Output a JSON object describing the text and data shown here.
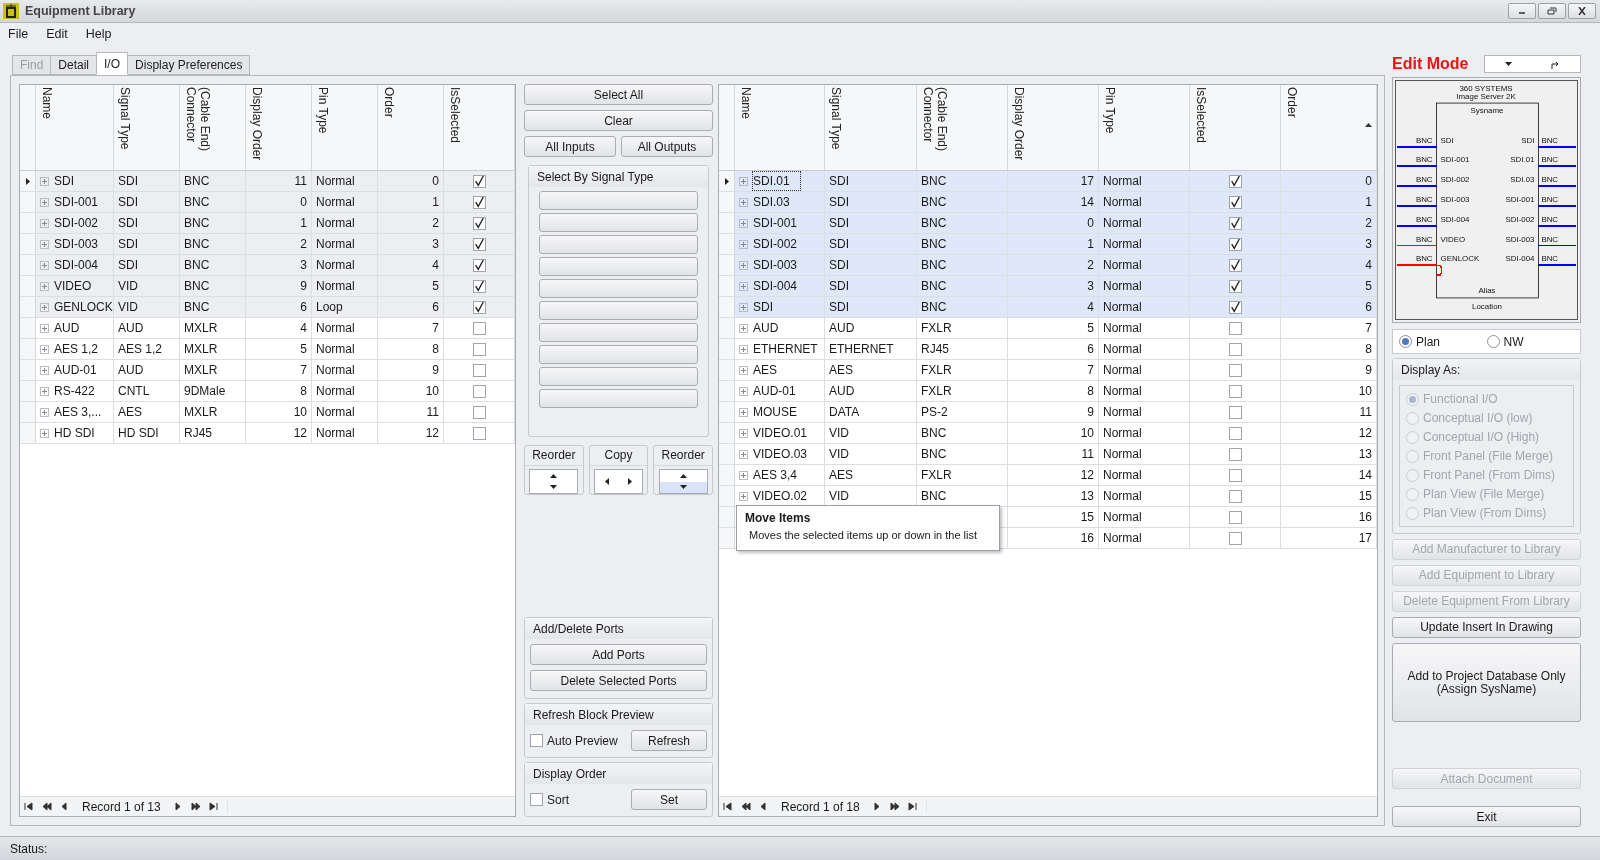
{
  "window": {
    "title": "Equipment Library"
  },
  "menu": [
    "File",
    "Edit",
    "Help"
  ],
  "tabs": [
    {
      "label": "Find",
      "selected": false,
      "disabled": true
    },
    {
      "label": "Detail",
      "selected": false,
      "disabled": false
    },
    {
      "label": "I/O",
      "selected": true,
      "disabled": false
    },
    {
      "label": "Display Preferences",
      "selected": false,
      "disabled": false
    }
  ],
  "left_grid": {
    "focused": false,
    "columns": [
      {
        "label": "Name",
        "kind": "name",
        "sorted": false
      },
      {
        "label": "Signal Type",
        "kind": "text",
        "sorted": false
      },
      {
        "label": "(Cable End) Connector",
        "kind": "text",
        "sorted": false
      },
      {
        "label": "Display Order",
        "kind": "number",
        "sorted": false
      },
      {
        "label": "Pin Type",
        "kind": "text",
        "sorted": false
      },
      {
        "label": "Order",
        "kind": "number",
        "sorted": false
      },
      {
        "label": "IsSelected",
        "kind": "check",
        "sorted": false
      }
    ],
    "rows": [
      {
        "current": true,
        "selected": true,
        "checked": true,
        "cells": [
          "SDI",
          "SDI",
          "BNC",
          "11",
          "Normal",
          "0"
        ]
      },
      {
        "current": false,
        "selected": true,
        "checked": true,
        "cells": [
          "SDI-001",
          "SDI",
          "BNC",
          "0",
          "Normal",
          "1"
        ]
      },
      {
        "current": false,
        "selected": true,
        "checked": true,
        "cells": [
          "SDI-002",
          "SDI",
          "BNC",
          "1",
          "Normal",
          "2"
        ]
      },
      {
        "current": false,
        "selected": true,
        "checked": true,
        "cells": [
          "SDI-003",
          "SDI",
          "BNC",
          "2",
          "Normal",
          "3"
        ]
      },
      {
        "current": false,
        "selected": true,
        "checked": true,
        "cells": [
          "SDI-004",
          "SDI",
          "BNC",
          "3",
          "Normal",
          "4"
        ]
      },
      {
        "current": false,
        "selected": true,
        "checked": true,
        "cells": [
          "VIDEO",
          "VID",
          "BNC",
          "9",
          "Normal",
          "5"
        ]
      },
      {
        "current": false,
        "selected": true,
        "checked": true,
        "cells": [
          "GENLOCK",
          "VID",
          "BNC",
          "6",
          "Loop",
          "6"
        ]
      },
      {
        "current": false,
        "selected": false,
        "checked": false,
        "cells": [
          "AUD",
          "AUD",
          "MXLR",
          "4",
          "Normal",
          "7"
        ]
      },
      {
        "current": false,
        "selected": false,
        "checked": false,
        "cells": [
          "AES 1,2",
          "AES 1,2",
          "MXLR",
          "5",
          "Normal",
          "8"
        ]
      },
      {
        "current": false,
        "selected": false,
        "checked": false,
        "cells": [
          "AUD-01",
          "AUD",
          "MXLR",
          "7",
          "Normal",
          "9"
        ]
      },
      {
        "current": false,
        "selected": false,
        "checked": false,
        "cells": [
          "RS-422",
          "CNTL",
          "9DMale",
          "8",
          "Normal",
          "10"
        ]
      },
      {
        "current": false,
        "selected": false,
        "checked": false,
        "cells": [
          "AES 3,...",
          "AES",
          "MXLR",
          "10",
          "Normal",
          "11"
        ]
      },
      {
        "current": false,
        "selected": false,
        "checked": false,
        "cells": [
          "HD SDI",
          "HD SDI",
          "RJ45",
          "12",
          "Normal",
          "12"
        ]
      }
    ],
    "navigator": "Record 1 of 13"
  },
  "middle": {
    "top_buttons": [
      "Select All",
      "Clear"
    ],
    "io_buttons": [
      "All Inputs",
      "All Outputs"
    ],
    "signal_group": {
      "title": "Select By Signal Type"
    },
    "move_groups": [
      {
        "title": "Reorder",
        "kind": "updown",
        "hovered": false
      },
      {
        "title": "Copy",
        "kind": "leftright",
        "hovered": false
      },
      {
        "title": "Reorder",
        "kind": "updown",
        "hovered": true
      }
    ],
    "ports_group": {
      "title": "Add/Delete Ports",
      "buttons": [
        "Add Ports",
        "Delete Selected Ports"
      ]
    },
    "refresh_group": {
      "title": "Refresh Block Preview",
      "checkbox": {
        "label": "Auto Preview",
        "checked": false
      },
      "button": "Refresh"
    },
    "order_group": {
      "title": "Display Order",
      "checkbox": {
        "label": "Sort",
        "checked": false
      },
      "button": "Set"
    }
  },
  "right_grid": {
    "focused": true,
    "columns": [
      {
        "label": "Name",
        "kind": "name",
        "sorted": false
      },
      {
        "label": "Signal Type",
        "kind": "text",
        "sorted": false
      },
      {
        "label": "(Cable End) Connector",
        "kind": "text",
        "sorted": false
      },
      {
        "label": "Display Order",
        "kind": "number",
        "sorted": false
      },
      {
        "label": "Pin Type",
        "kind": "text",
        "sorted": false
      },
      {
        "label": "IsSelected",
        "kind": "check",
        "sorted": false
      },
      {
        "label": "Order",
        "kind": "number",
        "sorted": true
      }
    ],
    "rows": [
      {
        "current": true,
        "selected": true,
        "checked": true,
        "cells": [
          "SDI.01",
          "SDI",
          "BNC",
          "17",
          "Normal",
          "0"
        ]
      },
      {
        "current": false,
        "selected": true,
        "checked": true,
        "cells": [
          "SDI.03",
          "SDI",
          "BNC",
          "14",
          "Normal",
          "1"
        ]
      },
      {
        "current": false,
        "selected": true,
        "checked": true,
        "cells": [
          "SDI-001",
          "SDI",
          "BNC",
          "0",
          "Normal",
          "2"
        ]
      },
      {
        "current": false,
        "selected": true,
        "checked": true,
        "cells": [
          "SDI-002",
          "SDI",
          "BNC",
          "1",
          "Normal",
          "3"
        ]
      },
      {
        "current": false,
        "selected": true,
        "checked": true,
        "cells": [
          "SDI-003",
          "SDI",
          "BNC",
          "2",
          "Normal",
          "4"
        ]
      },
      {
        "current": false,
        "selected": true,
        "checked": true,
        "cells": [
          "SDI-004",
          "SDI",
          "BNC",
          "3",
          "Normal",
          "5"
        ]
      },
      {
        "current": false,
        "selected": true,
        "checked": true,
        "cells": [
          "SDI",
          "SDI",
          "BNC",
          "4",
          "Normal",
          "6"
        ]
      },
      {
        "current": false,
        "selected": false,
        "checked": false,
        "cells": [
          "AUD",
          "AUD",
          "FXLR",
          "5",
          "Normal",
          "7"
        ]
      },
      {
        "current": false,
        "selected": false,
        "checked": false,
        "cells": [
          "ETHERNET",
          "ETHERNET",
          "RJ45",
          "6",
          "Normal",
          "8"
        ]
      },
      {
        "current": false,
        "selected": false,
        "checked": false,
        "cells": [
          "AES",
          "AES",
          "FXLR",
          "7",
          "Normal",
          "9"
        ]
      },
      {
        "current": false,
        "selected": false,
        "checked": false,
        "cells": [
          "AUD-01",
          "AUD",
          "FXLR",
          "8",
          "Normal",
          "10"
        ]
      },
      {
        "current": false,
        "selected": false,
        "checked": false,
        "cells": [
          "MOUSE",
          "DATA",
          "PS-2",
          "9",
          "Normal",
          "11"
        ]
      },
      {
        "current": false,
        "selected": false,
        "checked": false,
        "cells": [
          "VIDEO.01",
          "VID",
          "BNC",
          "10",
          "Normal",
          "12"
        ]
      },
      {
        "current": false,
        "selected": false,
        "checked": false,
        "cells": [
          "VIDEO.03",
          "VID",
          "BNC",
          "11",
          "Normal",
          "13"
        ]
      },
      {
        "current": false,
        "selected": false,
        "checked": false,
        "cells": [
          "AES 3,4",
          "AES",
          "FXLR",
          "12",
          "Normal",
          "14"
        ]
      },
      {
        "current": false,
        "selected": false,
        "checked": false,
        "cells": [
          "VIDEO.02",
          "VID",
          "BNC",
          "13",
          "Normal",
          "15"
        ]
      },
      {
        "current": false,
        "selected": false,
        "checked": false,
        "cells": [
          null,
          null,
          null,
          "15",
          "Normal",
          "16"
        ]
      },
      {
        "current": false,
        "selected": false,
        "checked": false,
        "cells": [
          null,
          null,
          null,
          "16",
          "Normal",
          "17"
        ]
      }
    ],
    "navigator": "Record 1 of 18",
    "tooltip": {
      "title": "Move Items",
      "text": "Moves the selected items up or down in the list"
    }
  },
  "sidebar": {
    "mode": "Edit Mode",
    "preview": {
      "title_lines": [
        "360 SYSTEMS",
        "Image Server 2K"
      ],
      "sysname": "Sysname",
      "alias": "Alias",
      "location": "Location",
      "inputs": [
        {
          "connector": "BNC",
          "name": "SDI",
          "color": "#0000ff",
          "loop": false
        },
        {
          "connector": "BNC",
          "name": "SDI-001",
          "color": "#0000ff",
          "loop": false
        },
        {
          "connector": "BNC",
          "name": "SDI-002",
          "color": "#0000ff",
          "loop": false
        },
        {
          "connector": "BNC",
          "name": "SDI-003",
          "color": "#0000ff",
          "loop": false
        },
        {
          "connector": "BNC",
          "name": "SDI-004",
          "color": "#0000ff",
          "loop": false
        },
        {
          "connector": "BNC",
          "name": "VIDEO",
          "color": "#ff0000",
          "loop": false
        },
        {
          "connector": "BNC",
          "name": "GENLOCK",
          "color": "#ff0000",
          "loop": true
        }
      ],
      "outputs": [
        {
          "connector": "BNC",
          "name": "SDI",
          "color": "#0000ff"
        },
        {
          "connector": "BNC",
          "name": "SDI.01",
          "color": "#0000ff"
        },
        {
          "connector": "BNC",
          "name": "SDI.03",
          "color": "#0000ff"
        },
        {
          "connector": "BNC",
          "name": "SDI-001",
          "color": "#0000ff"
        },
        {
          "connector": "BNC",
          "name": "SDI-002",
          "color": "#0000ff"
        },
        {
          "connector": "BNC",
          "name": "SDI-003",
          "color": "#0000ff"
        },
        {
          "connector": "BNC",
          "name": "SDI-004",
          "color": "#0000ff"
        }
      ]
    },
    "view_options": [
      {
        "label": "Plan",
        "selected": true
      },
      {
        "label": "NW",
        "selected": false
      }
    ],
    "display_as": {
      "title": "Display As:",
      "options": [
        {
          "label": "Functional I/O",
          "selected": true,
          "disabled": true
        },
        {
          "label": "Conceptual I/O (low)",
          "selected": false,
          "disabled": true
        },
        {
          "label": "Conceptual I/O (High)",
          "selected": false,
          "disabled": true
        },
        {
          "label": "Front Panel (File Merge)",
          "selected": false,
          "disabled": true
        },
        {
          "label": "Front Panel (From Dims)",
          "selected": false,
          "disabled": true
        },
        {
          "label": "Plan View (File Merge)",
          "selected": false,
          "disabled": true
        },
        {
          "label": "Plan View (From Dims)",
          "selected": false,
          "disabled": true
        }
      ]
    },
    "buttons": [
      {
        "label": "Add Manufacturer to Library",
        "disabled": true,
        "kind": "normal"
      },
      {
        "label": "Add Equipment to Library",
        "disabled": true,
        "kind": "normal"
      },
      {
        "label": "Delete Equipment From Library",
        "disabled": true,
        "kind": "normal"
      },
      {
        "label": "Update Insert In Drawing",
        "disabled": false,
        "kind": "normal"
      },
      {
        "label": "Add to Project Database Only\n(Assign SysName)",
        "disabled": false,
        "kind": "tall"
      }
    ],
    "bottom_buttons": [
      {
        "label": "Attach Document",
        "disabled": true
      },
      {
        "label": "Exit",
        "disabled": false
      }
    ]
  },
  "status_bar": {
    "label": "Status:"
  }
}
